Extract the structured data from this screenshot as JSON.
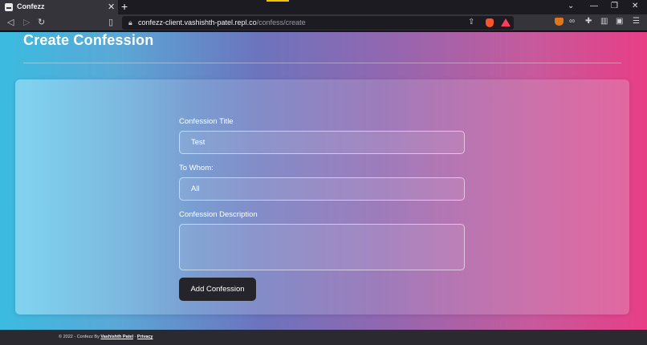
{
  "browser": {
    "tab": {
      "title": "Confezz",
      "close_glyph": "✕"
    },
    "new_tab_glyph": "+",
    "url_host": "confezz-client.vashishth-patel.repl.co",
    "url_path": "/confess/create",
    "window_controls": [
      "⌄",
      "—",
      "❐",
      "✕"
    ],
    "icons": [
      "back-icon",
      "forward-icon",
      "reload-icon",
      "bookmark-icon",
      "lock-icon",
      "share-icon",
      "brave-shields-icon",
      "brave-rewards-icon",
      "metamask-icon",
      "extensions-icon",
      "puzzle-icon",
      "sidebar-icon",
      "wallet-icon",
      "menu-icon"
    ]
  },
  "page": {
    "title": "Create Confession",
    "form": {
      "title_label": "Confession Title",
      "title_value": "Test",
      "to_label": "To Whom:",
      "to_value": "All",
      "description_label": "Confession Description",
      "description_value": "",
      "submit_label": "Add Confession"
    }
  },
  "footer": {
    "prefix": "© 2022 - Confezz By",
    "author_link": "Vashishth Patel",
    "separator": "-",
    "privacy_link": "Privacy"
  },
  "colors": {
    "gradient_left": "#3bbbe0",
    "gradient_mid": "#6c74bd",
    "gradient_right": "#e83e86",
    "button_bg": "#25242b",
    "browser_chrome": "#35343a"
  }
}
